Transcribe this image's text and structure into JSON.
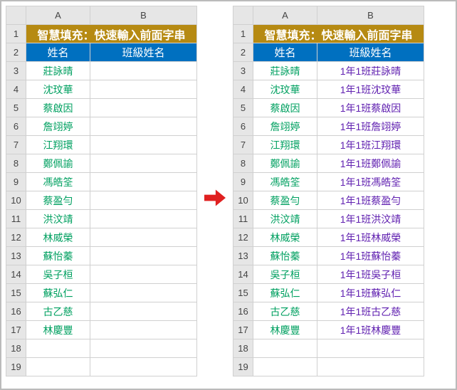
{
  "columns": [
    "A",
    "B"
  ],
  "title": "智慧填充：快速輸入前面字串",
  "headers": {
    "name": "姓名",
    "class_name": "班級姓名"
  },
  "row_numbers": [
    1,
    2,
    3,
    4,
    5,
    6,
    7,
    8,
    9,
    10,
    11,
    12,
    13,
    14,
    15,
    16,
    17,
    18,
    19
  ],
  "left": {
    "rows": [
      {
        "name": "莊詠晴",
        "class": ""
      },
      {
        "name": "沈玟華",
        "class": ""
      },
      {
        "name": "蔡啟因",
        "class": ""
      },
      {
        "name": "詹翊婷",
        "class": ""
      },
      {
        "name": "江翔環",
        "class": ""
      },
      {
        "name": "鄭佩諭",
        "class": ""
      },
      {
        "name": "馮皓筌",
        "class": ""
      },
      {
        "name": "蔡盈勻",
        "class": ""
      },
      {
        "name": "洪汶靖",
        "class": ""
      },
      {
        "name": "林威榮",
        "class": ""
      },
      {
        "name": "蘇怡蓁",
        "class": ""
      },
      {
        "name": "吳子桓",
        "class": ""
      },
      {
        "name": "蘇弘仁",
        "class": ""
      },
      {
        "name": "古乙慈",
        "class": ""
      },
      {
        "name": "林慶豐",
        "class": ""
      }
    ]
  },
  "right": {
    "rows": [
      {
        "name": "莊詠晴",
        "class": "1年1班莊詠晴"
      },
      {
        "name": "沈玟華",
        "class": "1年1班沈玟華"
      },
      {
        "name": "蔡啟因",
        "class": "1年1班蔡啟因"
      },
      {
        "name": "詹翊婷",
        "class": "1年1班詹翊婷"
      },
      {
        "name": "江翔環",
        "class": "1年1班江翔環"
      },
      {
        "name": "鄭佩諭",
        "class": "1年1班鄭佩諭"
      },
      {
        "name": "馮皓筌",
        "class": "1年1班馮皓筌"
      },
      {
        "name": "蔡盈勻",
        "class": "1年1班蔡盈勻"
      },
      {
        "name": "洪汶靖",
        "class": "1年1班洪汶靖"
      },
      {
        "name": "林威榮",
        "class": "1年1班林威榮"
      },
      {
        "name": "蘇怡蓁",
        "class": "1年1班蘇怡蓁"
      },
      {
        "name": "吳子桓",
        "class": "1年1班吳子桓"
      },
      {
        "name": "蘇弘仁",
        "class": "1年1班蘇弘仁"
      },
      {
        "name": "古乙慈",
        "class": "1年1班古乙慈"
      },
      {
        "name": "林慶豐",
        "class": "1年1班林慶豐"
      }
    ]
  }
}
